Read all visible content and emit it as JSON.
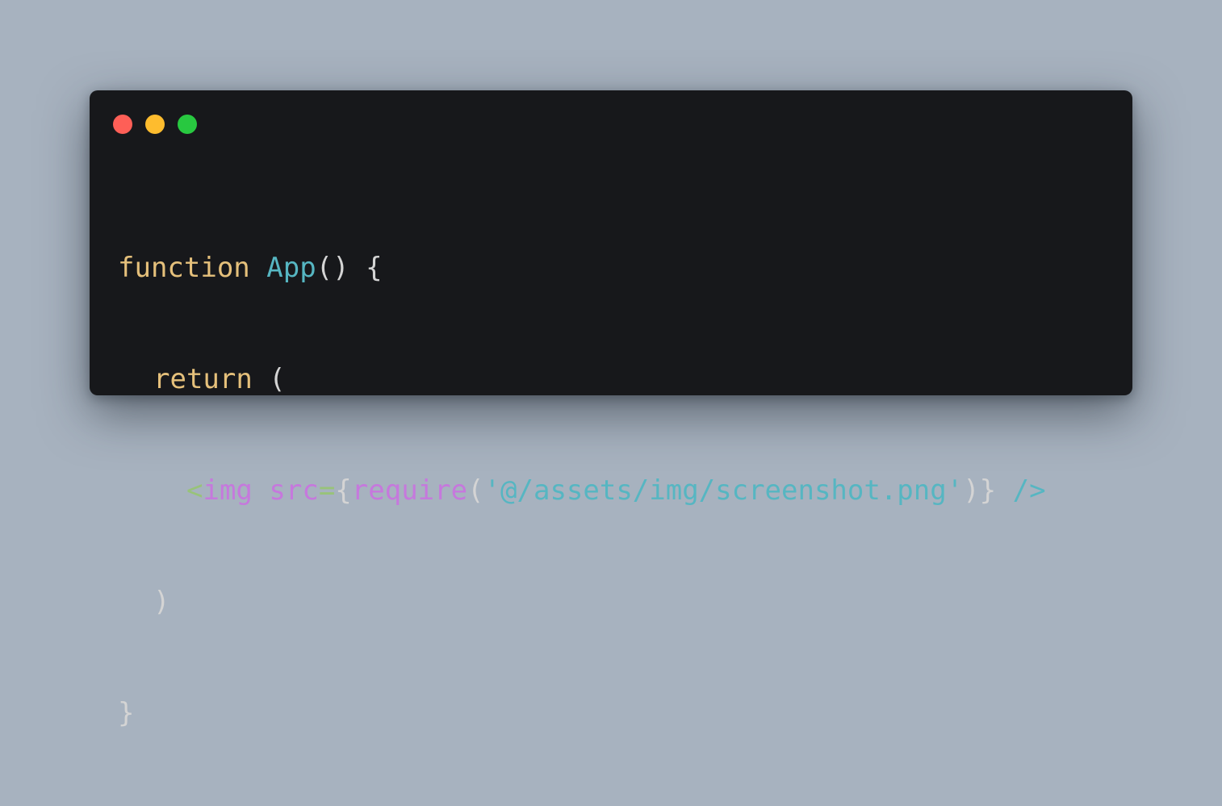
{
  "window": {
    "controls": [
      {
        "name": "close",
        "color": "#fe5f57"
      },
      {
        "name": "minimize",
        "color": "#febc2e"
      },
      {
        "name": "zoom",
        "color": "#28c840"
      }
    ]
  },
  "colors": {
    "keyword": "#e5c07b",
    "function_name": "#56b6c2",
    "punctuation": "#d4d4d4",
    "jsx_bracket": "#98c379",
    "jsx_tag": "#c678dd",
    "attribute": "#c678dd",
    "string": "#56b6c2"
  },
  "code": {
    "line1": {
      "keyword": "function",
      "space": " ",
      "name": "App",
      "parens": "()",
      "brace": " {"
    },
    "line2": {
      "keyword": "return",
      "paren": " ("
    },
    "line3": {
      "lt": "<",
      "tag": "img",
      "space": " ",
      "attr": "src",
      "eq": "=",
      "open_brace": "{",
      "call": "require",
      "open_paren": "(",
      "string": "'@/assets/img/screenshot.png'",
      "close_paren": ")",
      "close_brace": "}",
      "self_close": " />"
    },
    "line4": {
      "paren": ")"
    },
    "line5": {
      "brace": "}"
    }
  }
}
